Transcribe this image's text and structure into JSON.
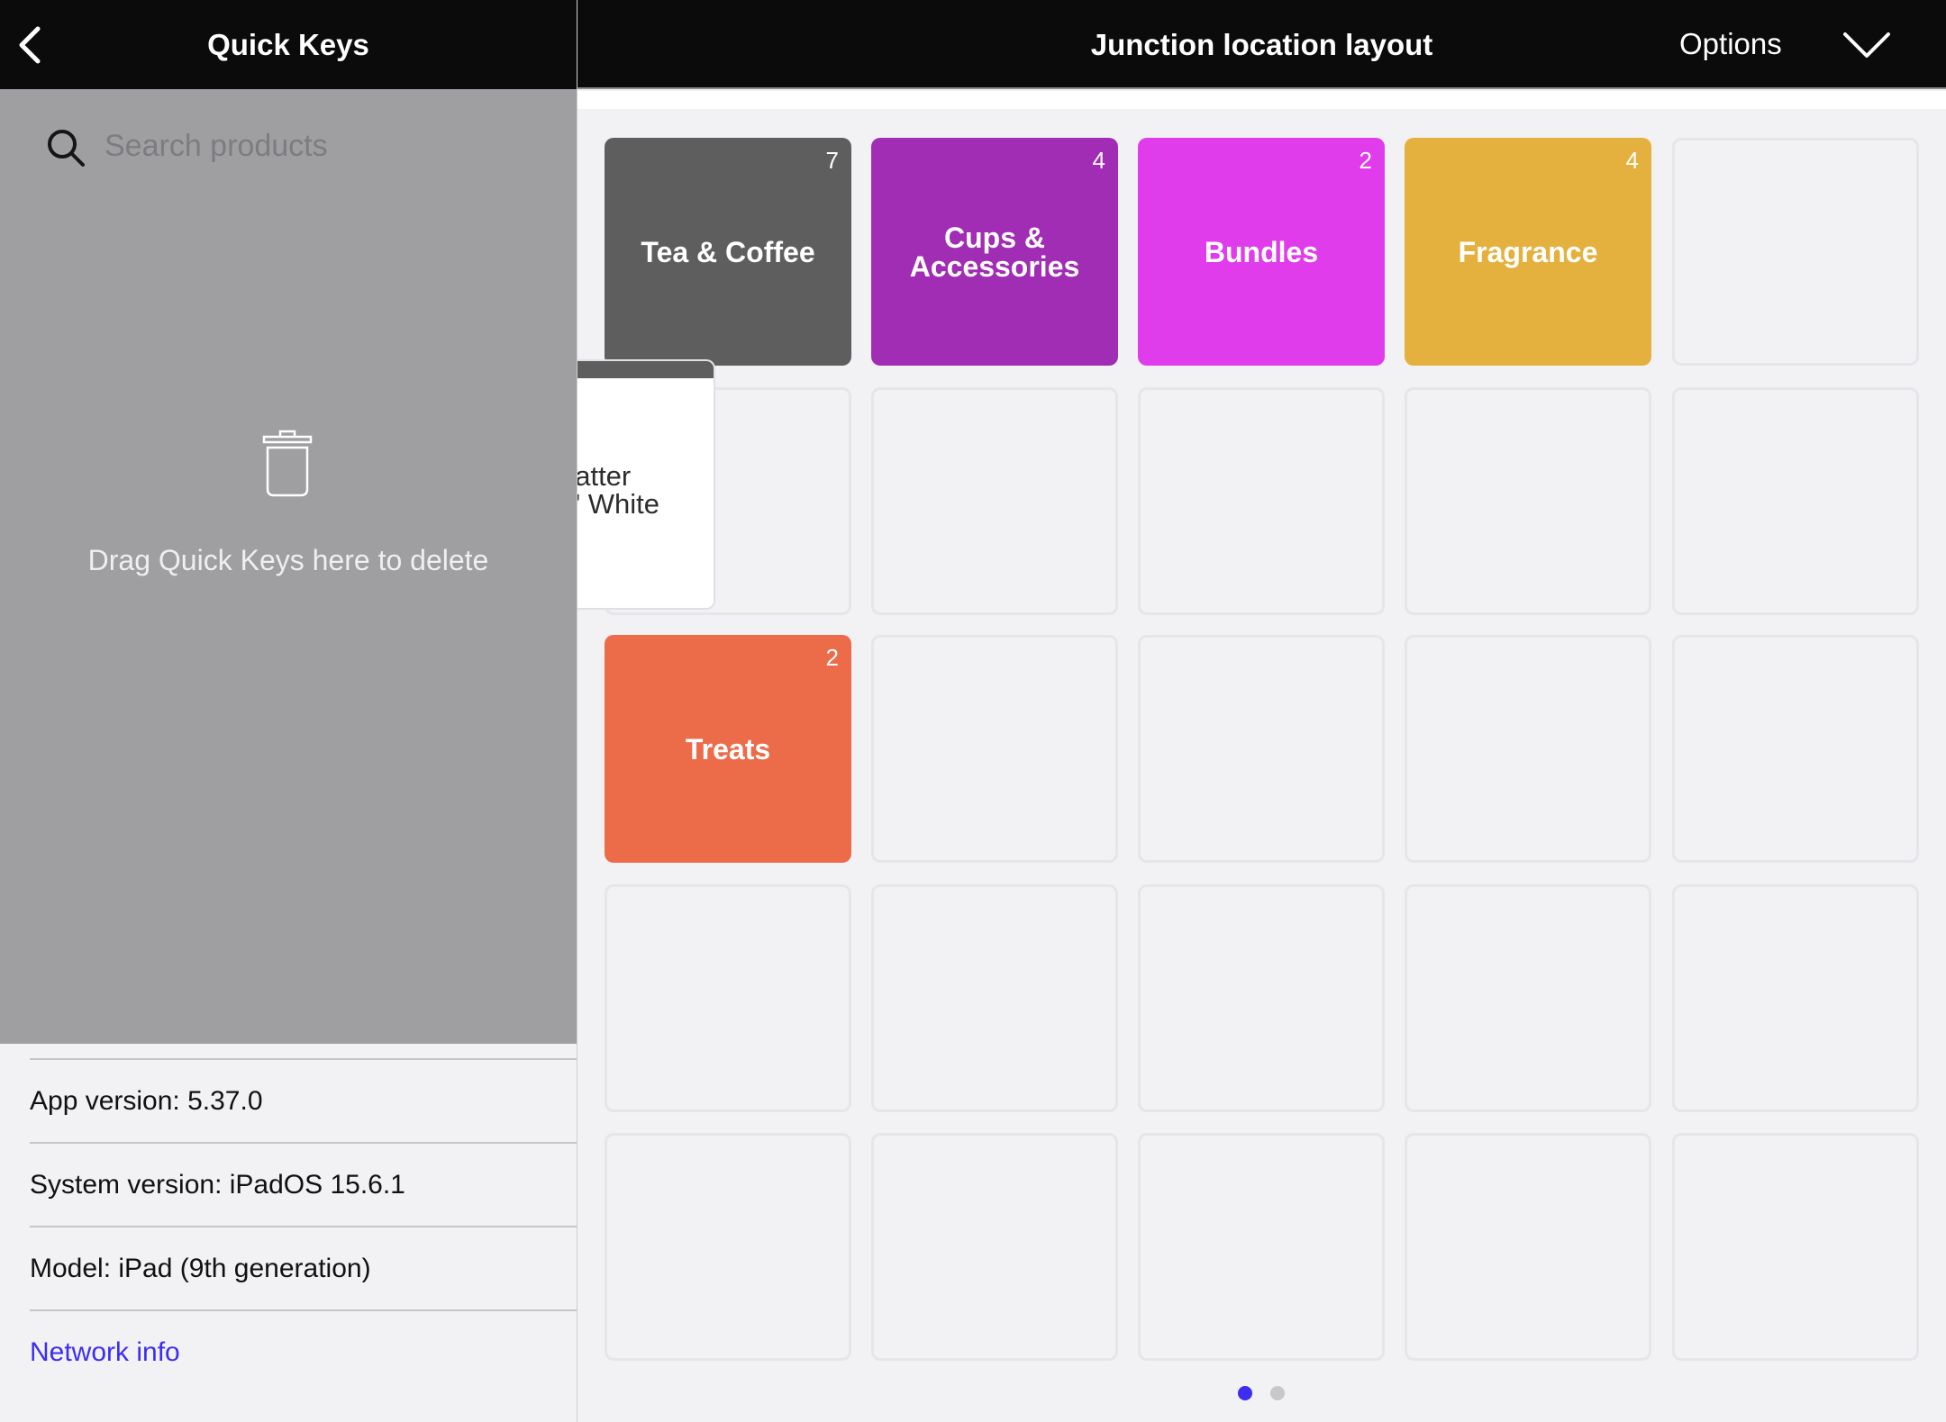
{
  "left_panel": {
    "title": "Quick Keys",
    "back_icon": "chevron-left-icon",
    "search": {
      "placeholder": "Search products",
      "value": "",
      "icon": "search-icon"
    },
    "delete_zone": {
      "icon": "trash-icon",
      "text": "Drag Quick Keys here to delete"
    },
    "info": [
      {
        "label": "App version: 5.37.0"
      },
      {
        "label": "System version: iPadOS 15.6.1"
      },
      {
        "label": "Model: iPad (9th generation)"
      }
    ],
    "network_link": "Network info"
  },
  "main": {
    "title": "Junction location layout",
    "options_label": "Options",
    "options_icon": "chevron-down-icon",
    "grid": {
      "columns": 5,
      "rows": 5,
      "tiles": [
        {
          "row": 0,
          "col": 0,
          "label": "Tea & Coffee",
          "count": "7",
          "color": "#5e5e5e"
        },
        {
          "row": 0,
          "col": 1,
          "label": "Cups & Accessories",
          "count": "4",
          "color": "#a02db3"
        },
        {
          "row": 0,
          "col": 2,
          "label": "Bundles",
          "count": "2",
          "color": "#e03ceb"
        },
        {
          "row": 0,
          "col": 3,
          "label": "Fragrance",
          "count": "4",
          "color": "#e4b13e"
        },
        {
          "row": 2,
          "col": 0,
          "label": "Treats",
          "count": "2",
          "color": "#ec6b48"
        }
      ]
    },
    "dragging_card": {
      "line1": "atter",
      "line2": "' White",
      "strip_color": "#5e5e5e"
    },
    "pagination": {
      "pages": 2,
      "current": 1,
      "active_color": "#3d2df0",
      "inactive_color": "#c8c8ca"
    }
  }
}
